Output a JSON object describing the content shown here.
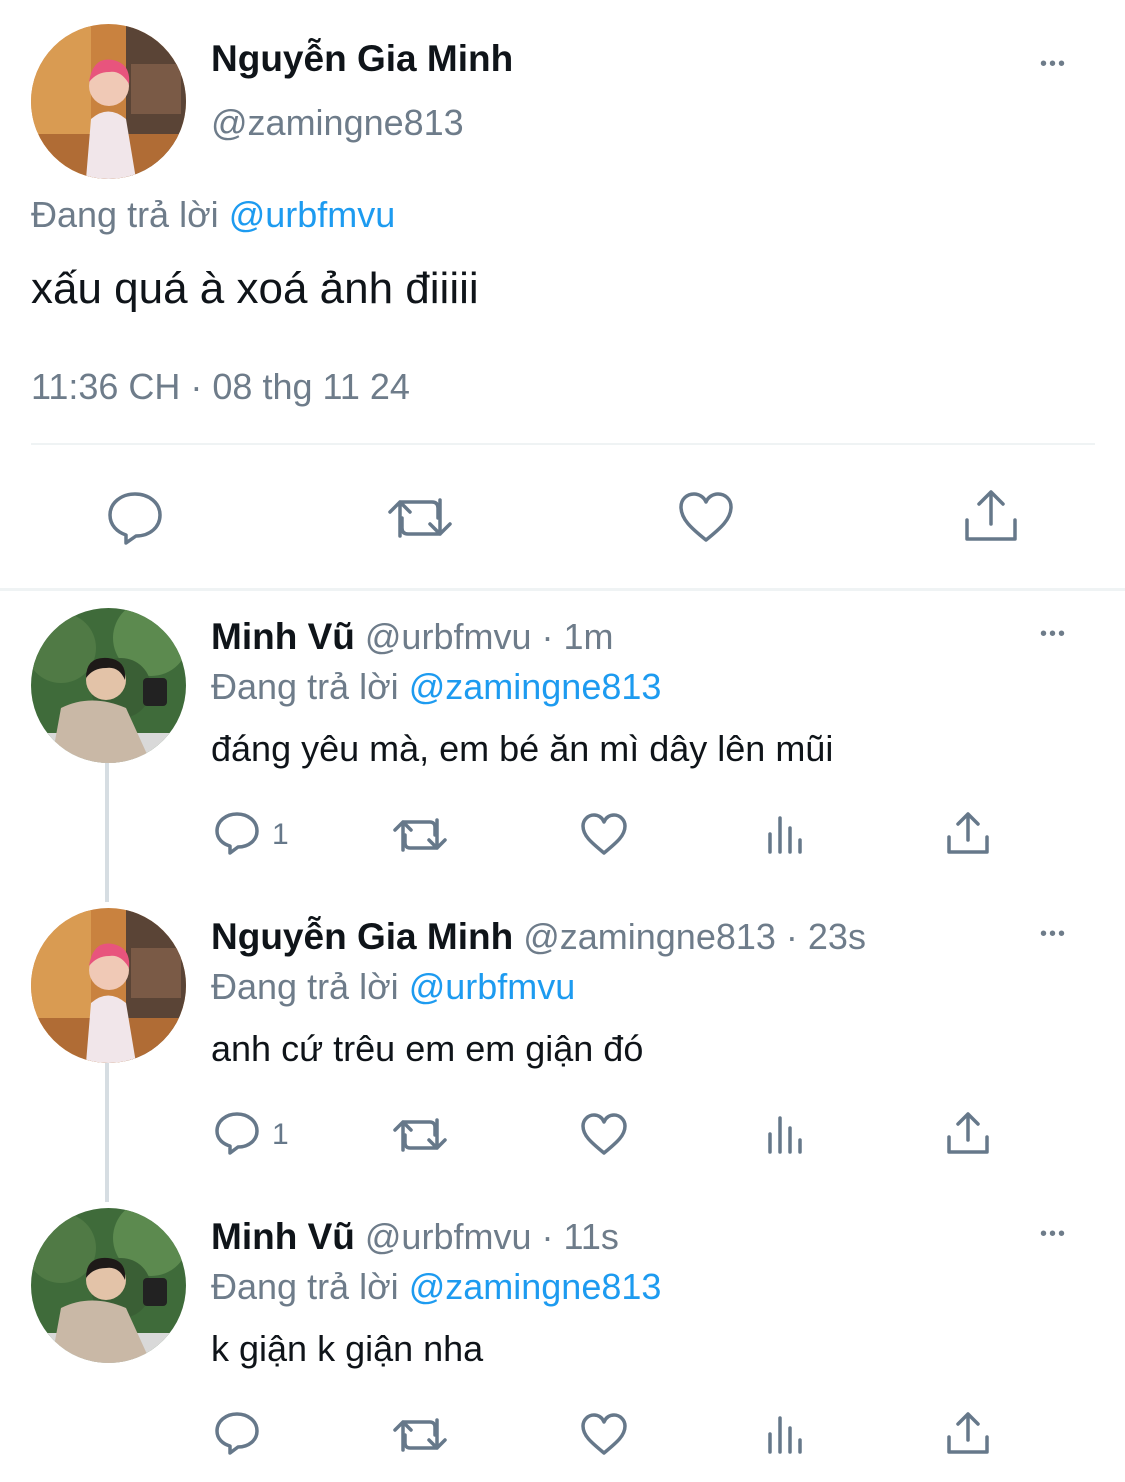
{
  "main_tweet": {
    "author_name": "Nguyễn Gia Minh",
    "author_handle": "@zamingne813",
    "reply_prefix": "Đang trả lời",
    "reply_to": "@urbfmvu",
    "text": "xấu quá à xoá ảnh điiiii",
    "timestamp": "11:36 CH · 08 thg 11 24",
    "more": "•••"
  },
  "replies": [
    {
      "author_name": "Minh Vũ",
      "author_handle": "@urbfmvu",
      "time": "· 1m",
      "reply_prefix": "Đang trả lời",
      "reply_to": "@zamingne813",
      "text": "đáng yêu mà, em bé ăn mì dây lên mũi",
      "reply_count": "1",
      "more": "•••"
    },
    {
      "author_name": "Nguyễn Gia Minh",
      "author_handle": "@zamingne813",
      "time": "· 23s",
      "reply_prefix": "Đang trả lời",
      "reply_to": "@urbfmvu",
      "text": "anh cứ trêu em em giận đó",
      "reply_count": "1",
      "more": "•••"
    },
    {
      "author_name": "Minh Vũ",
      "author_handle": "@urbfmvu",
      "time": "· 11s",
      "reply_prefix": "Đang trả lời",
      "reply_to": "@zamingne813",
      "text": "k giận k giận nha",
      "reply_count": "",
      "more": "•••"
    }
  ],
  "colors": {
    "link": "#1d9bf0",
    "muted": "#6e7c8a",
    "icon": "#66788a",
    "divider": "#eff3f4"
  }
}
